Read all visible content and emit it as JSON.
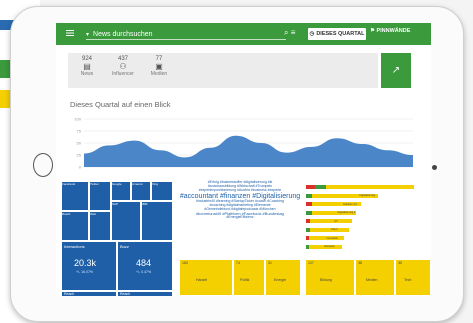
{
  "topbar": {
    "search_placeholder": "News durchsuchen",
    "quarter_button": "DIESES QUARTAL",
    "pin_button": "PINNWÄNDE"
  },
  "stats": {
    "news": {
      "value": "924",
      "label": "News"
    },
    "influencer": {
      "value": "437",
      "label": "Influencer"
    },
    "medien": {
      "value": "77",
      "label": "Medien"
    }
  },
  "section_title": "Dieses Quartal auf einen Blick",
  "chart_data": {
    "type": "area",
    "y_ticks": [
      "100",
      "75",
      "50",
      "25",
      "0"
    ],
    "ylim": [
      0,
      100
    ],
    "values": [
      28,
      45,
      55,
      35,
      20,
      40,
      65,
      50,
      30,
      42,
      60,
      48,
      35,
      25
    ],
    "color": "#4a86c8"
  },
  "treemap": {
    "interactions_label": "Interactions",
    "interactions_value": "20.3k",
    "interactions_sub": "+/- 16.07%",
    "buzz_label": "Buzz",
    "buzz_value": "484",
    "buzz_sub": "+/- 0.47%",
    "reach_label": "Reach",
    "reach2_label": "Reach",
    "cells": [
      "Facebook",
      "Twitter",
      "Google",
      "Amazon",
      "Xing",
      "Bosch",
      "Web",
      "SAP",
      "IBM"
    ]
  },
  "wordcloud": {
    "lines": [
      "#Erfolg #businessoffer #digitalisierung #ki",
      "#coachausbildung #Wirtschaft #Trumpeln",
      "#expertenpositionierung #Austria #business #experte",
      "#accountant #finanzen #Digitalisierung",
      "#industrie40 #learning #StartupTicker #coach #Coaching",
      "#coaching #digitalmarketing #Elemente",
      "#Gemeindebund #digitalepodcasts #München",
      "#kommunal40 #Plattform #Facebook #Bundestag",
      "#EnergieEffizienz"
    ]
  },
  "hbars": {
    "labels": [
      "",
      "Digitalisierung",
      "Industrie 4.0",
      "Digitalisierung 2",
      "IoT",
      "Cloud",
      "Innovation",
      "Netzwerk"
    ]
  },
  "bottom_yellow": {
    "labels": [
      "183",
      "74",
      "31",
      "127",
      "38",
      "35"
    ],
    "sub_labels": [
      "Handel",
      "Politik",
      "Energie",
      "Bildung",
      "Medien",
      "Tech"
    ]
  },
  "colors": {
    "green": "#3a9a3c",
    "blue": "#1e5fa8",
    "yellow": "#f5d000",
    "area": "#4a86c8"
  }
}
